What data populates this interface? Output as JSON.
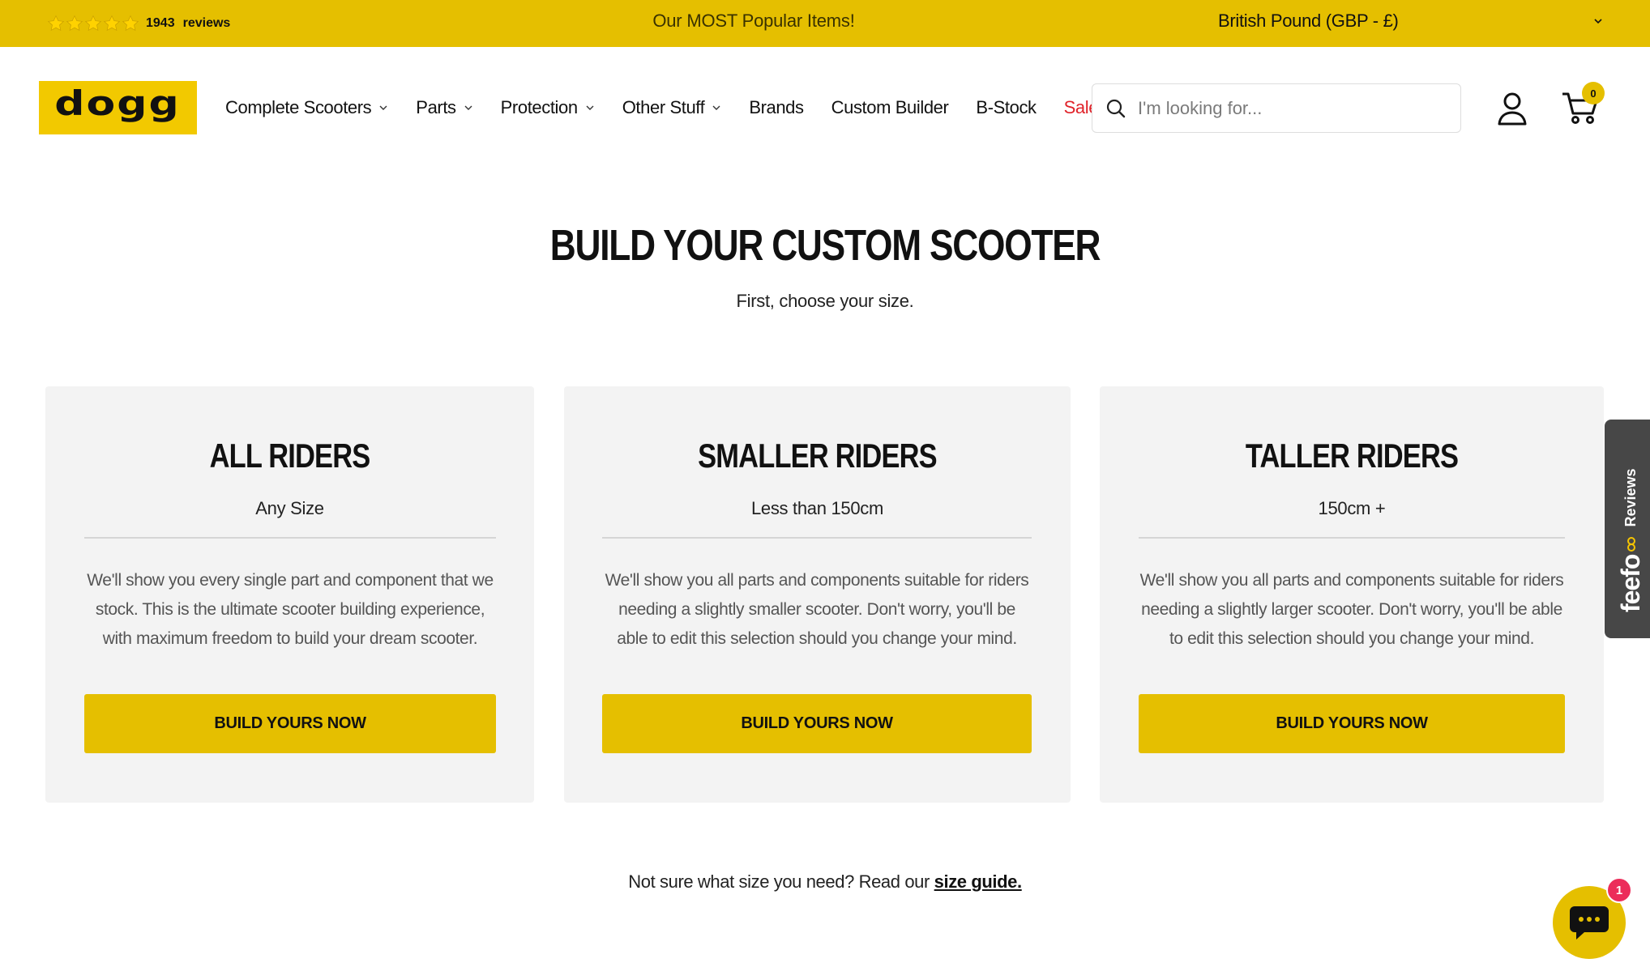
{
  "topbar": {
    "rating_stars": 5,
    "review_count": "1943",
    "review_label": "reviews",
    "promo": "Our MOST Popular Items!",
    "currency": "British Pound (GBP - £)"
  },
  "header": {
    "logo_text": "dogg",
    "nav": [
      {
        "label": "Complete Scooters",
        "has_dropdown": true
      },
      {
        "label": "Parts",
        "has_dropdown": true
      },
      {
        "label": "Protection",
        "has_dropdown": true
      },
      {
        "label": "Other Stuff",
        "has_dropdown": true
      },
      {
        "label": "Brands",
        "has_dropdown": false
      },
      {
        "label": "Custom Builder",
        "has_dropdown": false
      },
      {
        "label": "B-Stock",
        "has_dropdown": false
      },
      {
        "label": "Sale",
        "has_dropdown": false
      }
    ],
    "search_placeholder": "I'm looking for...",
    "cart_count": "0"
  },
  "hero": {
    "title": "BUILD YOUR CUSTOM SCOOTER",
    "subtitle": "First, choose your size."
  },
  "cards": [
    {
      "title": "ALL RIDERS",
      "size": "Any Size",
      "description": "We'll show you every single part and component that we stock. This is the ultimate scooter building experience, with maximum freedom to build your dream scooter.",
      "button": "BUILD YOURS NOW"
    },
    {
      "title": "SMALLER RIDERS",
      "size": "Less than 150cm",
      "description": "We'll show you all parts and components suitable for riders needing a slightly smaller scooter. Don't worry, you'll be able to edit this selection should you change your mind.",
      "button": "BUILD YOURS NOW"
    },
    {
      "title": "TALLER RIDERS",
      "size": "150cm +",
      "description": "We'll show you all parts and components suitable for riders needing a slightly larger scooter. Don't worry, you'll be able to edit this selection should you change your mind.",
      "button": "BUILD YOURS NOW"
    }
  ],
  "size_guide": {
    "text": "Not sure what size you need? Read our ",
    "link": "size guide."
  },
  "feefo": {
    "logo": "feefo",
    "label": "Reviews"
  },
  "chat": {
    "badge": "1"
  },
  "colors": {
    "brand_yellow": "#e5bf00",
    "sale_red": "#e0232a",
    "card_bg": "#f3f3f3",
    "chat_badge": "#ec2d5a",
    "feefo_bg": "#474747"
  },
  "icons": {
    "rating": "star-icon",
    "currency": "chevron-down-icon",
    "search": "search-icon",
    "account": "user-icon",
    "cart": "cart-icon",
    "chat": "chat-bubble-icon"
  }
}
